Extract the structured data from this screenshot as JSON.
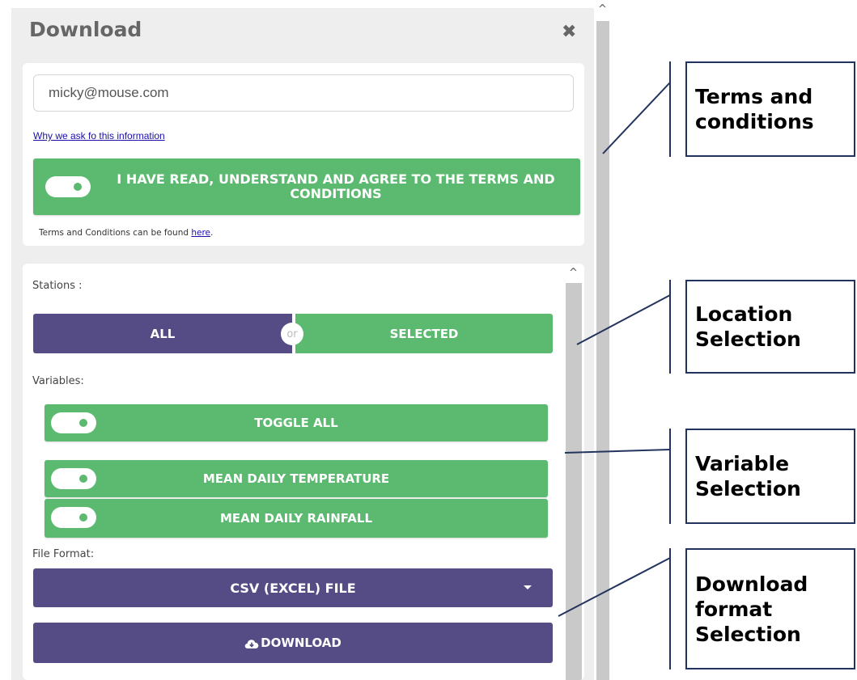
{
  "panel": {
    "title": "Download",
    "close_icon": "close-icon"
  },
  "terms": {
    "email_value": "micky@mouse.com",
    "why_link": "Why we ask fo this information",
    "agree_label": "I HAVE READ, UNDERSTAND AND AGREE TO THE TERMS AND CONDITIONS",
    "agree_toggle_on": true,
    "note_prefix": "Terms and Conditions can be found ",
    "note_link": "here",
    "note_suffix": "."
  },
  "stations": {
    "label": "Stations :",
    "all": "ALL",
    "or": "or",
    "selected": "SELECTED",
    "active": "ALL"
  },
  "variables": {
    "label": "Variables:",
    "items": [
      {
        "label": "TOGGLE ALL",
        "on": true
      },
      {
        "label": "MEAN DAILY TEMPERATURE",
        "on": true
      },
      {
        "label": "MEAN DAILY RAINFALL",
        "on": true
      }
    ]
  },
  "file_format": {
    "label": "File Format:",
    "selected": "CSV (EXCEL) FILE"
  },
  "download": {
    "label": "DOWNLOAD",
    "icon": "cloud-download-icon"
  },
  "annotations": {
    "terms": "Terms and conditions",
    "location": "Location Selection",
    "variable": "Variable Selection",
    "download_format": "Download format Selection"
  },
  "colors": {
    "green": "#5cb970",
    "purple": "#554c85",
    "panel_bg": "#eeeeee",
    "annotation_border": "#22345e"
  }
}
